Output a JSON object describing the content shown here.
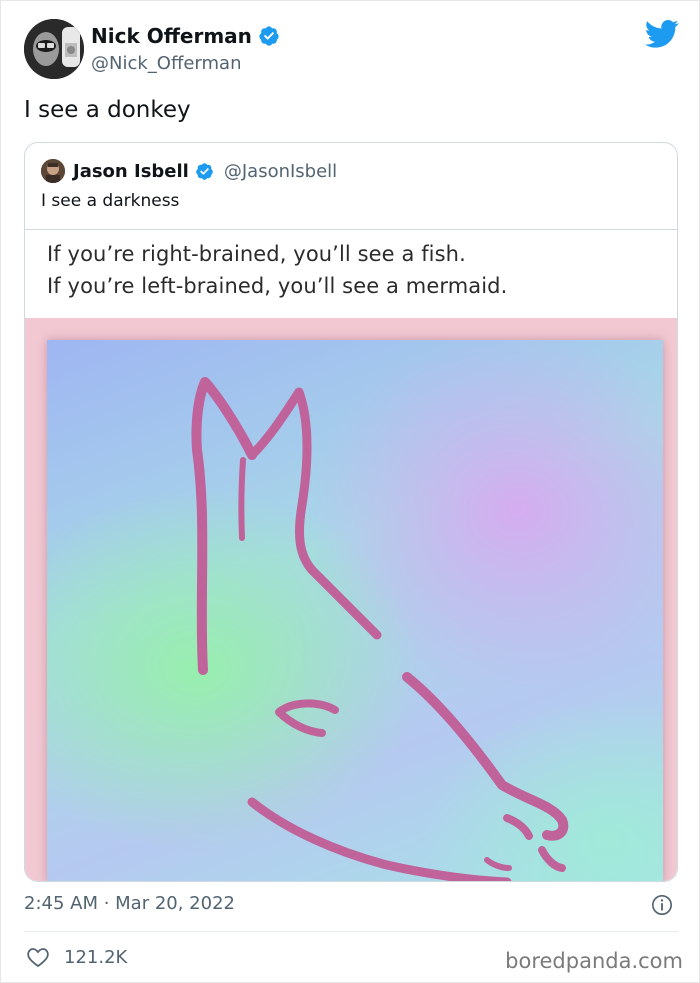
{
  "tweet": {
    "author": {
      "name": "Nick Offerman",
      "handle": "@Nick_Offerman"
    },
    "text": "I see a donkey",
    "timestamp": "2:45 AM · Mar 20, 2022",
    "likes": "121.2K"
  },
  "quoted": {
    "author": {
      "name": "Jason Isbell",
      "handle": "@JasonIsbell"
    },
    "text": "I see a darkness",
    "meme": {
      "line1": "If you’re right-brained, you’ll see a fish.",
      "line2": "If you’re left-brained, you’ll see a mermaid."
    }
  },
  "watermark": "boredpanda.com",
  "colors": {
    "verified": "#1d9bf0",
    "twitter_blue": "#1d9bf0",
    "drawing_stroke": "#c0639b",
    "frame_pink": "#f2c9d3"
  },
  "icons": [
    "verified-badge-icon",
    "twitter-bird-icon",
    "info-icon",
    "heart-icon"
  ]
}
